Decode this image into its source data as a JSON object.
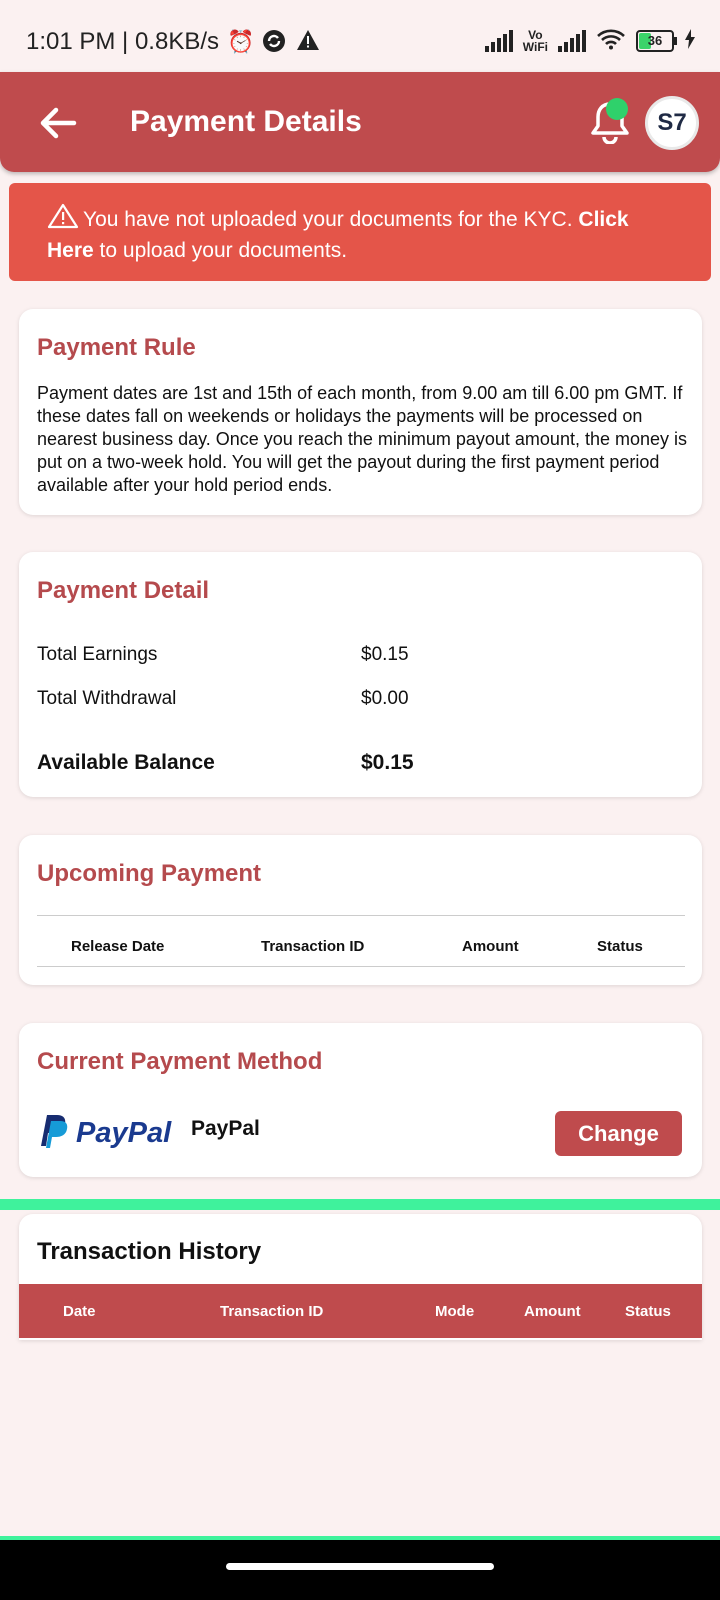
{
  "status_bar": {
    "time_speed": "1:01 PM | 0.8KB/s",
    "vowifi_top": "Vo",
    "vowifi_bottom": "WiFi",
    "battery": "36"
  },
  "header": {
    "title": "Payment Details",
    "avatar_text": "S7"
  },
  "kyc_banner": {
    "text": "You have not uploaded your documents for the KYC.",
    "link_text": "Click Here",
    "suffix": "to upload your documents."
  },
  "payment_rule": {
    "title": "Payment Rule",
    "text": "Payment dates are 1st and 15th of each month, from 9.00 am till 6.00 pm GMT. If these dates fall on weekends or holidays the payments will be processed on nearest business day. Once you reach the minimum payout amount, the money is put on a two-week hold. You will get the payout during the first payment period available after your hold period ends."
  },
  "payment_detail": {
    "title": "Payment Detail",
    "total_earnings_label": "Total Earnings",
    "total_earnings_value": "$0.15",
    "total_withdrawal_label": "Total Withdrawal",
    "total_withdrawal_value": "$0.00",
    "available_balance_label": "Available Balance",
    "available_balance_value": "$0.15"
  },
  "upcoming_payment": {
    "title": "Upcoming Payment",
    "columns": [
      "Release Date",
      "Transaction ID",
      "Amount",
      "Status"
    ]
  },
  "payment_method": {
    "title": "Current Payment Method",
    "logo_text": "PayPal",
    "label": "PayPal",
    "change_label": "Change"
  },
  "transaction_history": {
    "title": "Transaction History",
    "columns": [
      "Date",
      "Transaction ID",
      "Mode",
      "Amount",
      "Status"
    ]
  },
  "colors": {
    "brand": "#bf4b4d",
    "banner": "#e45549",
    "accent_green": "#3ff29c"
  }
}
